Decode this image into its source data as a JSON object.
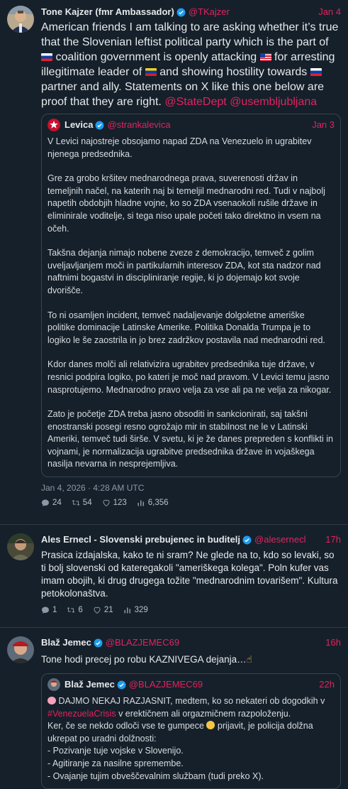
{
  "tweets": [
    {
      "name": "Tone Kajzer (fmr Ambassador)",
      "handle": "@TKajzer",
      "time": "Jan 4",
      "text_parts": [
        "American friends I am talking to are asking whether it’s true that the Slovenian leftist political party which is the part of ",
        " coalition government is openly attacking ",
        " for arresting illegitimate leader of ",
        " and showing hostility towards ",
        " partner and ally. Statements on X like this one below are proof that they are right. "
      ],
      "mentions": "@StateDept @usembljubljana",
      "quote": {
        "name": "Levica",
        "handle": "@strankalevica",
        "time": "Jan 3",
        "paragraphs": [
          "V Levici najostreje obsojamo napad ZDA na Venezuelo in ugrabitev njenega predsednika.",
          "Gre za grobo kršitev mednarodnega prava, suverenosti držav in temeljnih načel, na katerih naj bi temeljil mednarodni red. Tudi v najbolj napetih obdobjih hladne vojne, ko so ZDA vsenaokoli rušile države in eliminirale voditelje, si tega niso upale početi tako direktno in vsem na očeh.",
          "Takšna dejanja nimajo nobene zveze z demokracijo, temveč z golim uveljavljanjem moči in partikularnih interesov ZDA, kot sta nadzor nad naftnimi bogastvi in discipliniranje regije, ki jo dojemajo kot svoje dvorišče.",
          "To ni osamljen incident, temveč nadaljevanje dolgoletne ameriške politike dominacije Latinske Amerike. Politika Donalda Trumpa je to logiko le še zaostrila in jo brez zadržkov postavila nad mednarodni red.",
          "Kdor danes molči ali relativizira ugrabitev predsednika tuje države, v resnici podpira logiko, po kateri je moč nad pravom. V Levici temu jasno nasprotujemo. Mednarodno pravo velja za vse ali pa ne velja za nikogar.",
          "Zato je početje ZDA treba jasno obsoditi in sankcionirati, saj takšni enostranski posegi resno ogrožajo mir in stabilnost ne le v Latinski Ameriki, temveč tudi širše. V svetu, ki je že danes prepreden s konflikti in vojnami, je normalizacija ugrabitve predsednika države in vojaškega nasilja nevarna in nesprejemljiva."
        ]
      },
      "date": "Jan 4, 2026 · 4:28 AM UTC",
      "stats": {
        "replies": "24",
        "retweets": "54",
        "likes": "123",
        "views": "6,356"
      }
    },
    {
      "name": "Ales Ernecl - Slovenski prebujenec in buditelj",
      "handle": "@alesernecl",
      "time": "17h",
      "text": "Prasica izdajalska, kako te ni sram? Ne glede na to, kdo so levaki, so ti bolj slovenski od kateregakoli \"ameriškega kolega\". Poln kufer vas imam obojih, ki drug drugega tožite \"mednarodnim tovarišem\". Kultura petokolonaštva.",
      "stats": {
        "replies": "1",
        "retweets": "6",
        "likes": "21",
        "views": "329"
      }
    },
    {
      "name": "Blaž Jemec",
      "handle": "@BLAZJEMEC69",
      "time": "16h",
      "text": "Tone hodi precej po robu KAZNIVEGA dejanja…",
      "quote": {
        "name": "Blaž Jemec",
        "handle": "@BLAZJEMEC69",
        "time": "22h",
        "line1": "DAJMO NEKAJ RAZJASNIT, medtem, ko so nekateri ob dogodkih v",
        "hashtag": "#VenezuelaCrisis",
        "line1b": " v erektičnem ali orgazmičnem razpoloženju.",
        "line2a": "Ker, če se nekdo odloči vse te gumpece ",
        "line2b": " prijavit, je policija dolžna ukrepat po uradni dolžnosti:",
        "items": [
          "- Pozivanje tuje vojske v Slovenijo.",
          "- Agitiranje za nasilne spremembe.",
          "- Ovajanje tujim obveščevalnim službam (tudi preko X)."
        ]
      }
    }
  ]
}
